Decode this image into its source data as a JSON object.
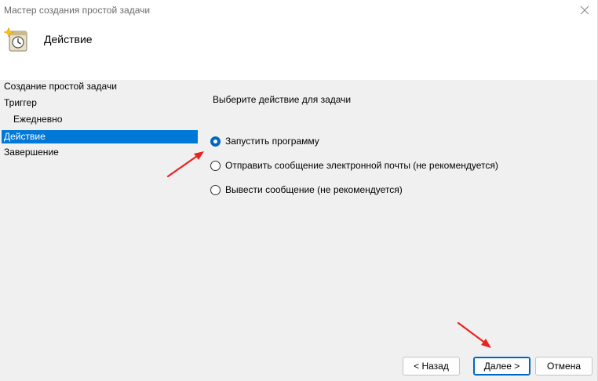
{
  "window": {
    "title": "Мастер создания простой задачи",
    "header_title": "Действие",
    "close_icon": "close-icon"
  },
  "sidebar": {
    "items": [
      {
        "label": "Создание простой задачи",
        "active": false,
        "sub": false
      },
      {
        "label": "Триггер",
        "active": false,
        "sub": false
      },
      {
        "label": "Ежедневно",
        "active": false,
        "sub": true
      },
      {
        "label": "Действие",
        "active": true,
        "sub": false
      },
      {
        "label": "Завершение",
        "active": false,
        "sub": false
      }
    ]
  },
  "main": {
    "prompt": "Выберите действие для задачи",
    "options": [
      {
        "label": "Запустить программу",
        "checked": true
      },
      {
        "label": "Отправить сообщение электронной почты (не рекомендуется)",
        "checked": false
      },
      {
        "label": "Вывести сообщение (не рекомендуется)",
        "checked": false
      }
    ]
  },
  "buttons": {
    "back": "< Назад",
    "next": "Далее >",
    "cancel": "Отмена"
  },
  "colors": {
    "selection": "#0078d7",
    "accent": "#0067c0",
    "annotation_arrow": "#e8231f"
  }
}
